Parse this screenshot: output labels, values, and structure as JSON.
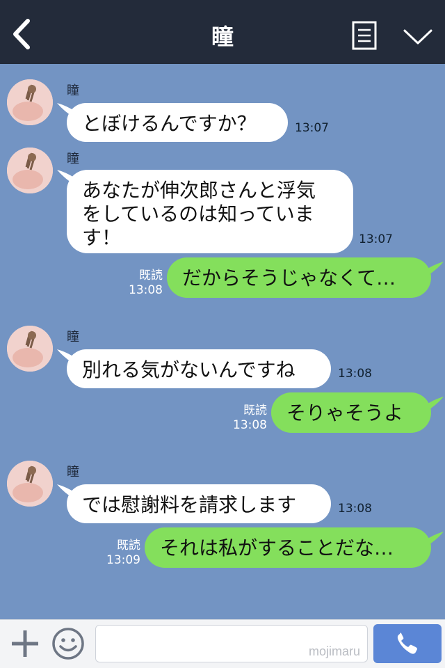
{
  "header": {
    "title": "瞳",
    "back_icon": "chevron-left-icon",
    "menu_icon": "menu-list-icon",
    "collapse_icon": "chevron-down-icon"
  },
  "messages": [
    {
      "side": "left",
      "sender": "瞳",
      "lines": [
        "とぼけるんですか？"
      ],
      "time": "13:07"
    },
    {
      "side": "left",
      "sender": "瞳",
      "lines": [
        "あなたが伸次郎さんと浮気",
        "をしているのは知っていま",
        "す！"
      ],
      "time": "13:07"
    },
    {
      "side": "right",
      "read": "既読",
      "time": "13:08",
      "lines": [
        "だからそうじゃなくて…"
      ]
    },
    {
      "side": "left",
      "sender": "瞳",
      "lines": [
        "別れる気がないんですね"
      ],
      "time": "13:08"
    },
    {
      "side": "right",
      "read": "既読",
      "time": "13:08",
      "lines": [
        "そりゃそうよ"
      ]
    },
    {
      "side": "left",
      "sender": "瞳",
      "lines": [
        "では慰謝料を請求します"
      ],
      "time": "13:08"
    },
    {
      "side": "right",
      "read": "既読",
      "time": "13:09",
      "lines": [
        "それは私がすることだな…"
      ]
    }
  ],
  "footer": {
    "input_value": "",
    "watermark": "mojimaru",
    "plus_icon": "plus-icon",
    "emoji_icon": "smiley-icon",
    "send_icon": "phone-icon"
  },
  "colors": {
    "background": "#7394c3",
    "header": "#232b3a",
    "bubble_left": "#ffffff",
    "bubble_right": "#84df5c",
    "send_button": "#5b86d6"
  }
}
